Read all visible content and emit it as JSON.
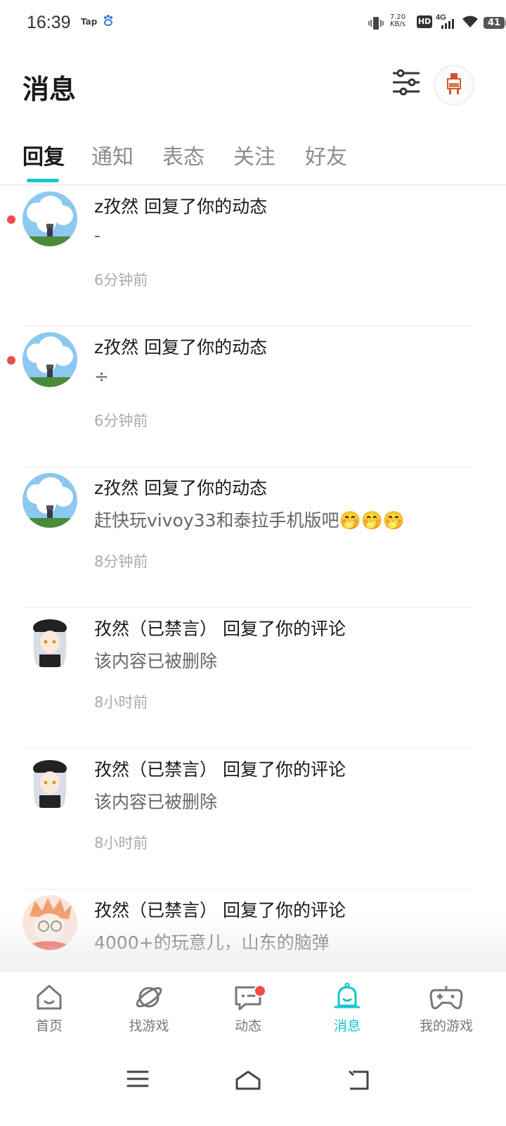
{
  "status_bar": {
    "time": "16:39",
    "app_badge": "Tap",
    "net_speed_value": "7.20",
    "net_speed_unit": "KB/s",
    "hd": "HD",
    "network": "4G",
    "battery": "41"
  },
  "header": {
    "title": "消息"
  },
  "tabs": [
    {
      "label": "回复",
      "active": true
    },
    {
      "label": "通知"
    },
    {
      "label": "表态"
    },
    {
      "label": "关注"
    },
    {
      "label": "好友"
    }
  ],
  "messages": [
    {
      "title": "z孜然 回复了你的动态",
      "body": "-",
      "time": "6分钟前",
      "unread": true,
      "avatar": "sky-pixel-avatar"
    },
    {
      "title": "z孜然 回复了你的动态",
      "body": "÷",
      "time": "6分钟前",
      "unread": true,
      "avatar": "sky-pixel-avatar"
    },
    {
      "title": "z孜然 回复了你的动态",
      "body": "赶快玩vivoy33和泰拉手机版吧🤭🤭🤭",
      "time": "8分钟前",
      "unread": false,
      "avatar": "sky-pixel-avatar"
    },
    {
      "title": "孜然（已禁言） 回复了你的评论",
      "body": "该内容已被删除",
      "time": "8小时前",
      "unread": false,
      "avatar": "anime-girl-avatar"
    },
    {
      "title": "孜然（已禁言） 回复了你的评论",
      "body": "该内容已被删除",
      "time": "8小时前",
      "unread": false,
      "avatar": "anime-girl-avatar"
    },
    {
      "title": "孜然（已禁言） 回复了你的评论",
      "body": "4000+的玩意儿，山东的脑弹",
      "time": "",
      "unread": false,
      "avatar": "anime-boy-avatar"
    }
  ],
  "bottom_nav": [
    {
      "label": "首页",
      "icon": "home-icon"
    },
    {
      "label": "找游戏",
      "icon": "planet-icon"
    },
    {
      "label": "动态",
      "icon": "chat-icon",
      "badge": true
    },
    {
      "label": "消息",
      "icon": "bell-icon",
      "active": true
    },
    {
      "label": "我的游戏",
      "icon": "gamepad-icon"
    }
  ],
  "colors": {
    "accent": "#15c5ce",
    "unread_dot": "#f04b4b"
  }
}
